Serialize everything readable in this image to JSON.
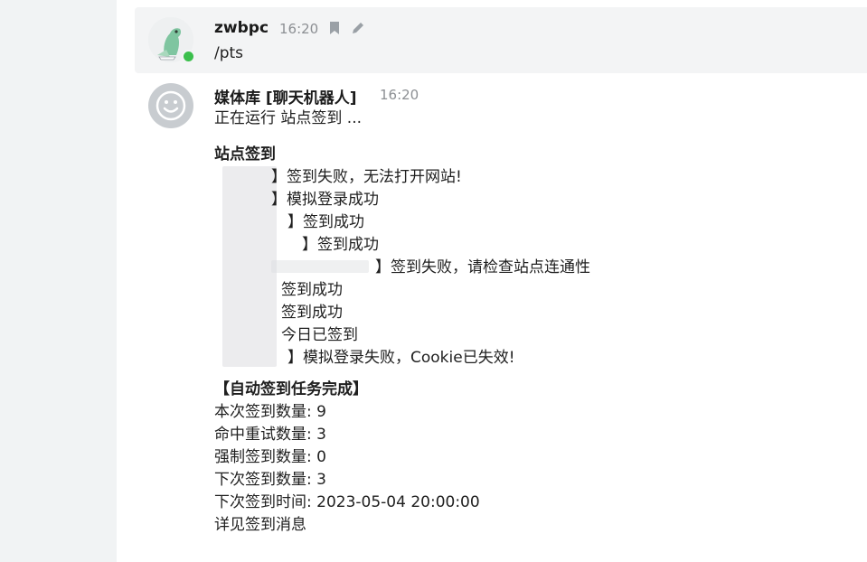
{
  "user_message": {
    "author": "zwbpc",
    "time": "16:20",
    "text": "/pts",
    "action_icons": [
      "bookmark-icon",
      "pencil-icon"
    ]
  },
  "bot_message": {
    "author": "媒体库 [聊天机器人]",
    "time": "16:20",
    "running_line": "正在运行 站点签到 ...",
    "section_title": "站点签到",
    "site_results": [
      "】签到失败，无法打开网站!",
      "】模拟登录成功",
      "】签到成功",
      "】签到成功",
      "】签到失败，请检查站点连通性",
      "签到成功",
      "签到成功",
      "今日已签到",
      "】模拟登录失败，Cookie已失效!"
    ],
    "summary_title": "【自动签到任务完成】",
    "summary_lines": [
      "本次签到数量: 9",
      "命中重试数量: 3",
      "强制签到数量: 0",
      "下次签到数量: 3",
      "下次签到时间: 2023-05-04 20:00:00",
      "详见签到消息"
    ]
  },
  "colors": {
    "online_status": "#3bbf4c",
    "highlight_bg": "#f3f4f5",
    "timestamp": "#8c8f93"
  }
}
